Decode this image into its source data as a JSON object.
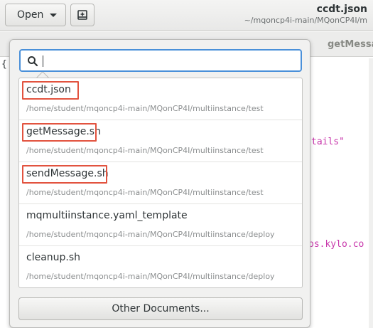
{
  "header": {
    "open_label": "Open",
    "title": "ccdt.json",
    "subtitle": "~/mqoncp4i-main/MQonCP4I/m"
  },
  "background": {
    "tab_label": "getMessa",
    "code_brace": "{",
    "code_string_1": "tails\"",
    "code_string_2": "ps.kylo.co"
  },
  "popover": {
    "search": {
      "value": "",
      "placeholder": ""
    },
    "documents": [
      {
        "name": "ccdt.json",
        "path": "/home/student/mqoncp4i-main/MQonCP4I/multiinstance/test",
        "highlighted": true
      },
      {
        "name": "getMessage.sh",
        "path": "/home/student/mqoncp4i-main/MQonCP4I/multiinstance/test",
        "highlighted": true
      },
      {
        "name": "sendMessage.sh",
        "path": "/home/student/mqoncp4i-main/MQonCP4I/multiinstance/test",
        "highlighted": true
      },
      {
        "name": "mqmultiinstance.yaml_template",
        "path": "/home/student/mqoncp4i-main/MQonCP4I/multiinstance/deploy",
        "highlighted": false
      },
      {
        "name": "cleanup.sh",
        "path": "/home/student/mqoncp4i-main/MQonCP4I/multiinstance/deploy",
        "highlighted": false
      }
    ],
    "other_documents_label": "Other Documents..."
  },
  "colors": {
    "accent": "#4a90d9",
    "highlight_box": "#e2533f",
    "code_string": "#c837ab"
  }
}
